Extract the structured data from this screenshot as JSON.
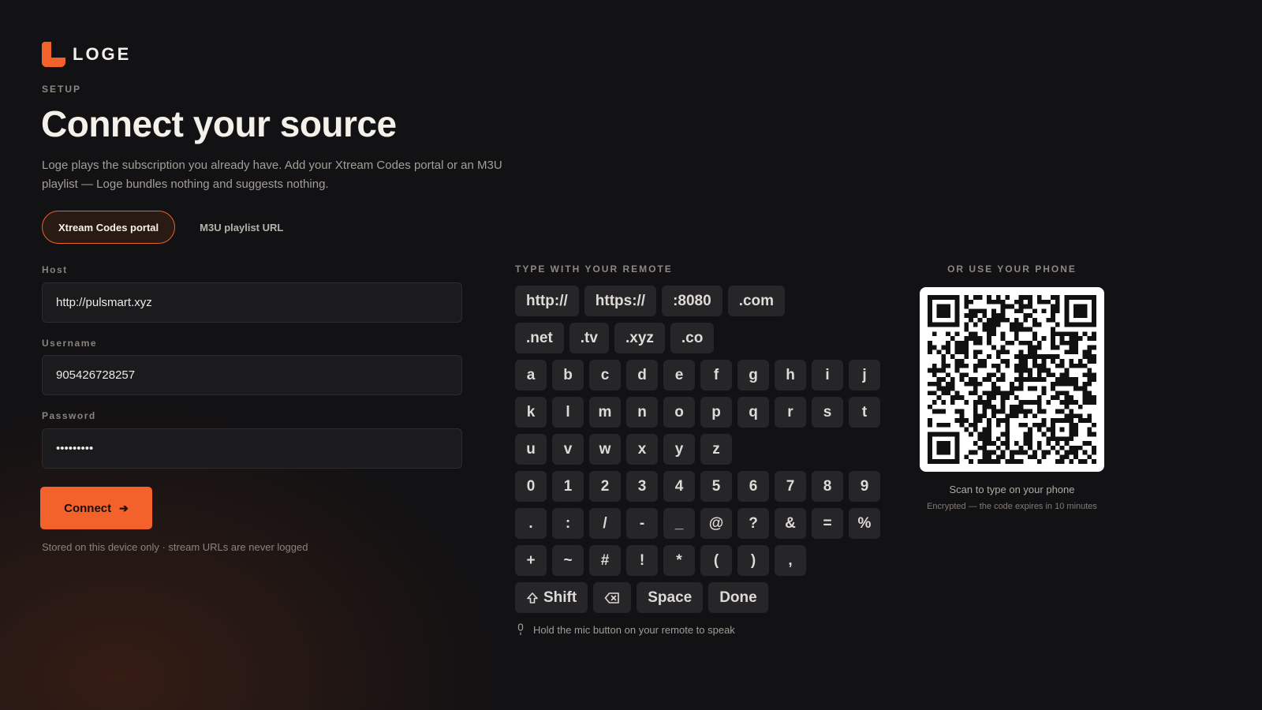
{
  "brand": {
    "name": "LOGE",
    "accent": "#f2622a"
  },
  "header": {
    "eyebrow": "SETUP",
    "title": "Connect your source",
    "lead": "Loge plays the subscription you already have. Add your Xtream Codes portal or an M3U playlist — Loge bundles nothing and suggests nothing."
  },
  "tabs": [
    {
      "label": "Xtream Codes portal",
      "active": true
    },
    {
      "label": "M3U playlist URL",
      "active": false
    }
  ],
  "form": {
    "host": {
      "label": "Host",
      "value": "http://pulsmart.xyz"
    },
    "username": {
      "label": "Username",
      "value": "905426728257"
    },
    "password": {
      "label": "Password",
      "value": "123456789"
    },
    "connect_label": "Connect",
    "storage_note": "Stored on this device only · stream URLs are never logged"
  },
  "keyboard": {
    "title": "TYPE WITH YOUR REMOTE",
    "shortcuts_row1": [
      "http://",
      "https://",
      ":8080",
      ".com"
    ],
    "shortcuts_row2": [
      ".net",
      ".tv",
      ".xyz",
      ".co"
    ],
    "letters_row1": [
      "a",
      "b",
      "c",
      "d",
      "e",
      "f",
      "g",
      "h",
      "i",
      "j"
    ],
    "letters_row2": [
      "k",
      "l",
      "m",
      "n",
      "o",
      "p",
      "q",
      "r",
      "s",
      "t"
    ],
    "letters_row3": [
      "u",
      "v",
      "w",
      "x",
      "y",
      "z"
    ],
    "digits": [
      "0",
      "1",
      "2",
      "3",
      "4",
      "5",
      "6",
      "7",
      "8",
      "9"
    ],
    "symbols_row1": [
      ".",
      ":",
      "/",
      "-",
      "_",
      "@",
      "?",
      "&",
      "=",
      "%"
    ],
    "symbols_row2": [
      "+",
      "~",
      "#",
      "!",
      "*",
      "(",
      ")",
      ","
    ],
    "shift_label": "Shift",
    "space_label": "Space",
    "done_label": "Done",
    "mic_hint": "Hold the mic button on your remote to speak"
  },
  "phone": {
    "title": "OR USE YOUR PHONE",
    "caption": "Scan to type on your phone",
    "sub": "Encrypted — the code expires in 10 minutes"
  }
}
